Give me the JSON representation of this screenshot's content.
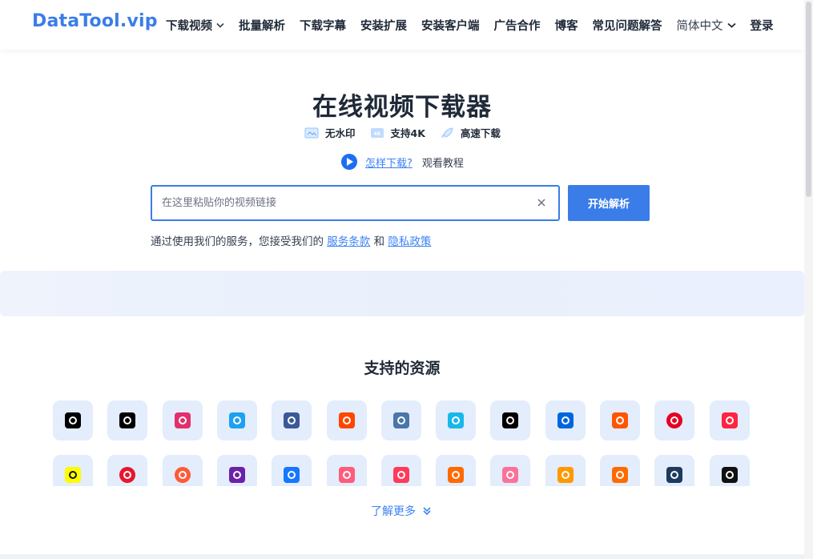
{
  "header": {
    "logo": "DataTool.vip",
    "nav": [
      {
        "label": "下载视频",
        "dropdown": true
      },
      {
        "label": "批量解析"
      },
      {
        "label": "下载字幕"
      },
      {
        "label": "安装扩展"
      },
      {
        "label": "安装客户端"
      },
      {
        "label": "广告合作"
      },
      {
        "label": "博客"
      },
      {
        "label": "常见问题解答"
      }
    ],
    "language": "简体中文",
    "login": "登录"
  },
  "hero": {
    "title": "在线视频下载器",
    "features": [
      "无水印",
      "支持4K",
      "高速下载"
    ],
    "howto_link": "怎样下载?",
    "howto_text": "观看教程"
  },
  "search": {
    "placeholder": "在这里粘贴你的视频链接",
    "value": "",
    "button": "开始解析"
  },
  "terms": {
    "prefix": "通过使用我们的服务，您接受我们的",
    "tos": "服务条款",
    "and": "和",
    "privacy": "隐私政策"
  },
  "resources": {
    "title": "支持的资源",
    "platforms": [
      {
        "name": "tiktok-icon",
        "color": "#000000"
      },
      {
        "name": "douyin-icon",
        "color": "#000000"
      },
      {
        "name": "instagram-icon",
        "color": "#e1306c"
      },
      {
        "name": "twitter-icon",
        "color": "#1da1f2"
      },
      {
        "name": "facebook-icon",
        "color": "#3b5998"
      },
      {
        "name": "reddit-icon",
        "color": "#ff4500"
      },
      {
        "name": "vk-icon",
        "color": "#4a76a8"
      },
      {
        "name": "vimeo-icon",
        "color": "#1ab7ea"
      },
      {
        "name": "threads-icon",
        "color": "#000000"
      },
      {
        "name": "dailymotion-icon",
        "color": "#0066dc"
      },
      {
        "name": "soundcloud-icon",
        "color": "#ff5500"
      },
      {
        "name": "pinterest-icon",
        "color": "#e60023"
      },
      {
        "name": "xiaohongshu-icon",
        "color": "#ff2442"
      },
      {
        "name": "snapchat-icon",
        "color": "#fffc00"
      },
      {
        "name": "weibo-icon",
        "color": "#e6162d"
      },
      {
        "name": "kuaishou-icon",
        "color": "#ff5a36"
      },
      {
        "name": "video-player-icon",
        "color": "#6b21a8"
      },
      {
        "name": "autohome-icon",
        "color": "#1677ff"
      },
      {
        "name": "pipixia-icon",
        "color": "#ff5c7a"
      },
      {
        "name": "mp-icon",
        "color": "#ff3b5c"
      },
      {
        "name": "kuaishou-orange-icon",
        "color": "#ff6a00"
      },
      {
        "name": "bilibili-pink-icon",
        "color": "#fb7299"
      },
      {
        "name": "amazon-icon",
        "color": "#ff9900"
      },
      {
        "name": "kuaishou-alt-icon",
        "color": "#ff6a00"
      },
      {
        "name": "capcut-icon",
        "color": "#1e3a5f"
      },
      {
        "name": "heart-app-icon",
        "color": "#111111"
      }
    ],
    "more": "了解更多"
  },
  "colors": {
    "accent": "#3b7de8",
    "link": "#3b82f6"
  }
}
